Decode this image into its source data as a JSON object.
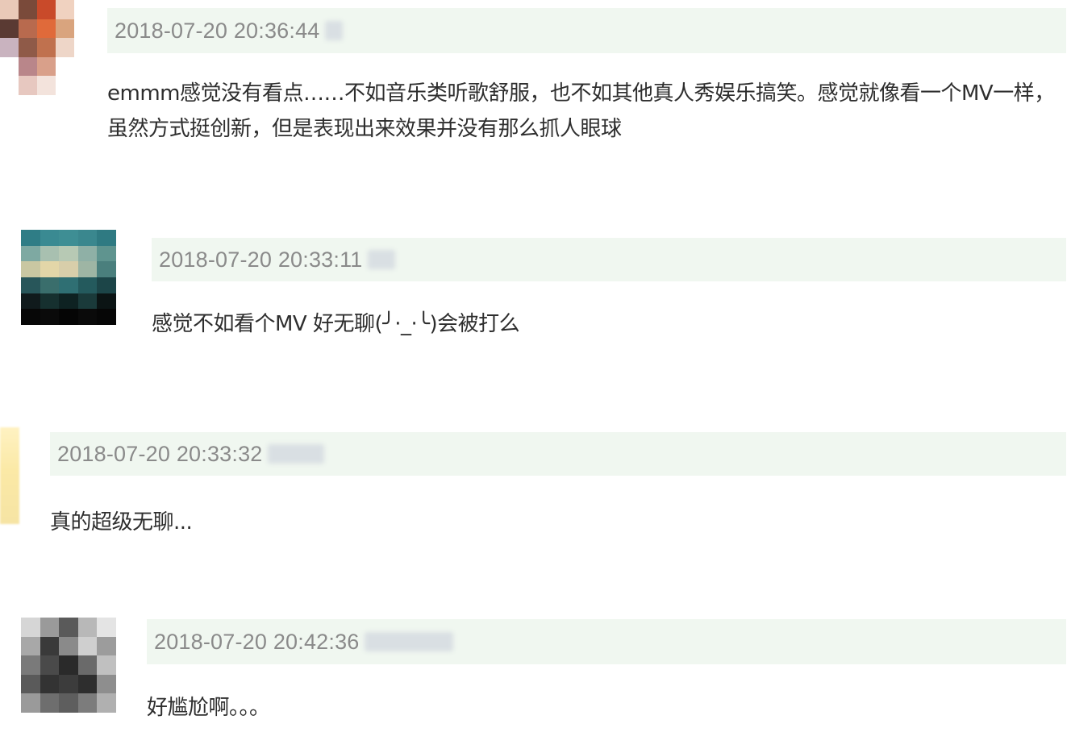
{
  "comments": [
    {
      "timestamp": "2018-07-20 20:36:44",
      "text": "emmm感觉没有看点……不如音乐类听歌舒服，也不如其他真人秀娱乐搞笑。感觉就像看一个MV一样，虽然方式挺创新，但是表现出来效果并没有那么抓人眼球"
    },
    {
      "timestamp": "2018-07-20 20:33:11",
      "text": "感觉不如看个MV 好无聊(╯·_·╰)会被打么"
    },
    {
      "timestamp": "2018-07-20 20:33:32",
      "text": "真的超级无聊..."
    },
    {
      "timestamp": "2018-07-20 20:42:36",
      "text": "好尴尬啊。。。"
    }
  ],
  "avatar_colors": {
    "c1": "#c0714e",
    "c2": "#2f6f73",
    "c4": "#4a4a4a"
  }
}
